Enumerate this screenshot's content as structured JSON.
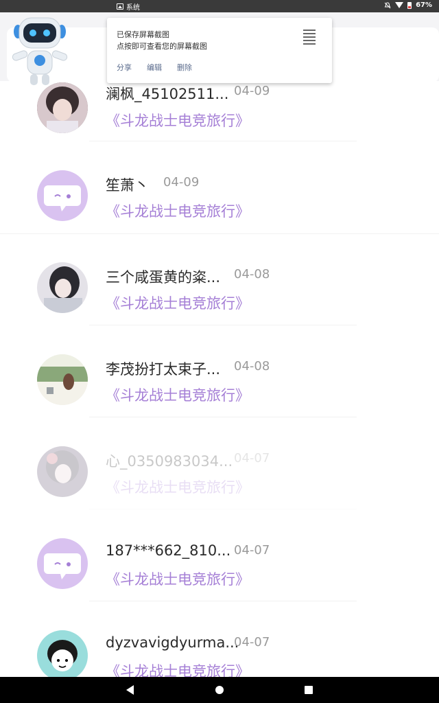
{
  "status_bar": {
    "app_label": "系统",
    "battery": "67%"
  },
  "notification": {
    "title": "已保存屏幕截图",
    "text": "点按即可查看您的屏幕截图",
    "actions": [
      "分享",
      "编辑",
      "删除"
    ]
  },
  "list": [
    {
      "name": "澜枫_45102511...",
      "date": "04-09",
      "game": "《斗龙战士电竞旅行》",
      "avatar": "photo-avatar",
      "faded": false
    },
    {
      "name": "笙萧丶",
      "date": "04-09",
      "game": "《斗龙战士电竞旅行》",
      "avatar": "chat-bubble-avatar",
      "faded": false
    },
    {
      "name": "三个咸蛋黄的粢...",
      "date": "04-08",
      "game": "《斗龙战士电竞旅行》",
      "avatar": "photo-avatar",
      "faded": false
    },
    {
      "name": "李茂扮打太束子...",
      "date": "04-08",
      "game": "《斗龙战士电竞旅行》",
      "avatar": "photo-avatar",
      "faded": false
    },
    {
      "name": "心_0350983034...",
      "date": "04-07",
      "game": "《斗龙战士电竞旅行》",
      "avatar": "photo-avatar",
      "faded": true
    },
    {
      "name": "187***662_810...",
      "date": "04-07",
      "game": "《斗龙战士电竞旅行》",
      "avatar": "chat-bubble-avatar",
      "faded": false
    },
    {
      "name": "dyzvavigdyurma...",
      "date": "04-07",
      "game": "《斗龙战士电竞旅行》",
      "avatar": "photo-avatar",
      "faded": false
    }
  ],
  "colors": {
    "accent": "#a57fd6",
    "avatar_bubble": "#d9c2f0"
  }
}
